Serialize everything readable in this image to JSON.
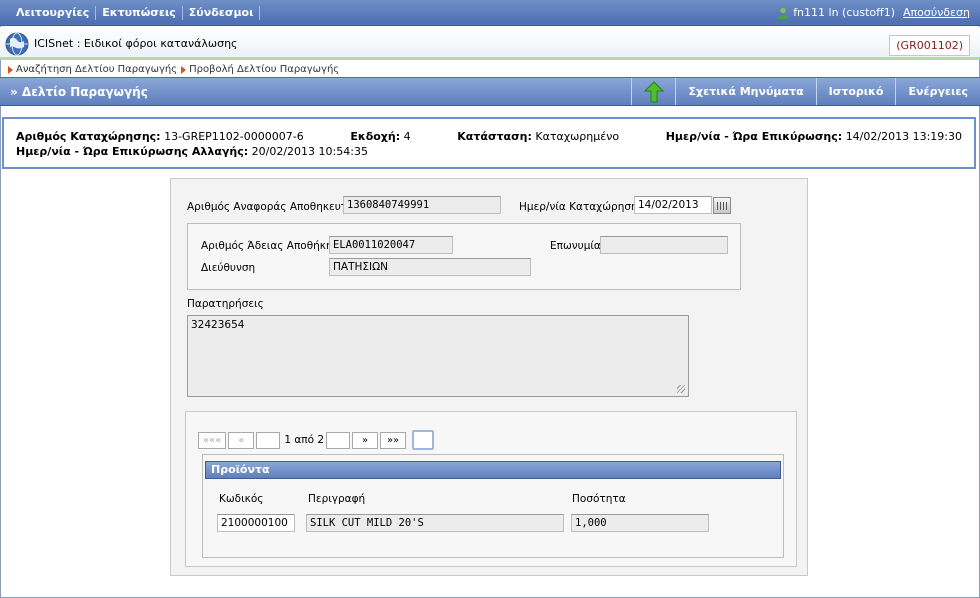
{
  "topbar": {
    "menu": [
      "Λειτουργίες",
      "Εκτυπώσεις",
      "Σύνδεσμοι"
    ],
    "user": "fn111 ln (custoff1)",
    "logout": "Αποσύνδεση"
  },
  "app": {
    "title": "ICISnet : Ειδικοί φόροι κατανάλωσης",
    "code": "(GR001102)"
  },
  "breadcrumb": [
    "Αναζήτηση Δελτίου Παραγωγής",
    "Προβολή Δελτίου Παραγωγής"
  ],
  "titlebar": {
    "caption": "» Δελτίο Παραγωγής",
    "actions": [
      "Σχετικά Μηνύματα",
      "Ιστορικό",
      "Ενέργειες"
    ]
  },
  "info": {
    "reg_label": "Αριθμός Καταχώρησης:",
    "reg_value": "13-GREP1102-0000007-6",
    "ver_label": "Εκδοχή:",
    "ver_value": "4",
    "status_label": "Κατάσταση:",
    "status_value": "Καταχωρημένο",
    "confirm_label": "Ημερ/νία - Ώρα Επικύρωσης:",
    "confirm_value": "14/02/2013 13:19:30",
    "change_label": "Ημερ/νία - Ώρα Επικύρωσης Αλλαγής:",
    "change_value": "20/02/2013 10:54:35"
  },
  "form": {
    "ref_label": "Αριθμός Αναφοράς Αποθηκευτή",
    "ref_value": "1360840749991",
    "date_label": "Ημερ/νία Καταχώρησης",
    "date_value": "14/02/2013",
    "license_label": "Αριθμός Άδειας Αποθήκης",
    "license_value": "ELA0011020047",
    "name_label": "Επωνυμία",
    "name_value": "",
    "address_label": "Διεύθυνση",
    "address_value": "ΠΑΤΗΣΙΩΝ",
    "notes_label": "Παρατηρήσεις",
    "notes_value": "32423654"
  },
  "pager": {
    "first": "«««",
    "prev": "«",
    "text": "1 από 2",
    "next": "»",
    "last": "»»"
  },
  "products": {
    "header": "Προϊόντα",
    "col_code": "Κωδικός",
    "col_desc": "Περιγραφή",
    "col_qty": "Ποσότητα",
    "rows": [
      {
        "code": "2100000100",
        "desc": "SILK CUT MILD 20'S",
        "qty": "1,000"
      }
    ]
  }
}
